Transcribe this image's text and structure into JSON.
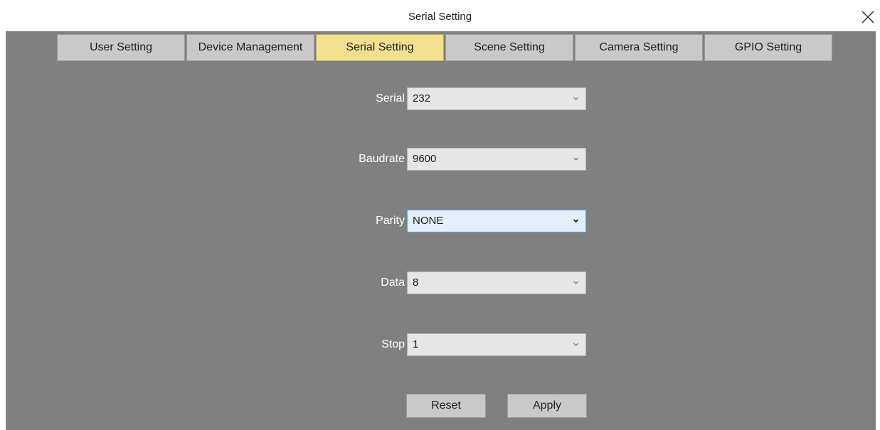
{
  "window": {
    "title": "Serial Setting",
    "close_icon": "close-icon"
  },
  "tabs": [
    {
      "label": "User Setting",
      "active": false
    },
    {
      "label": "Device Management",
      "active": false
    },
    {
      "label": "Serial Setting",
      "active": true
    },
    {
      "label": "Scene Setting",
      "active": false
    },
    {
      "label": "Camera Setting",
      "active": false
    },
    {
      "label": "GPIO Setting",
      "active": false
    }
  ],
  "form": {
    "serial": {
      "label": "Serial",
      "value": "232"
    },
    "baudrate": {
      "label": "Baudrate",
      "value": "9600"
    },
    "parity": {
      "label": "Parity",
      "value": "NONE"
    },
    "data": {
      "label": "Data",
      "value": "8"
    },
    "stop": {
      "label": "Stop",
      "value": "1"
    }
  },
  "buttons": {
    "reset_label": "Reset",
    "apply_label": "Apply"
  },
  "colors": {
    "panel_bg": "#808080",
    "active_tab": "#f3e08f",
    "tab_bg": "#c9c9c9",
    "focused_select": "#e3effa"
  },
  "icons": {
    "dropdown": "chevron-down-icon"
  }
}
